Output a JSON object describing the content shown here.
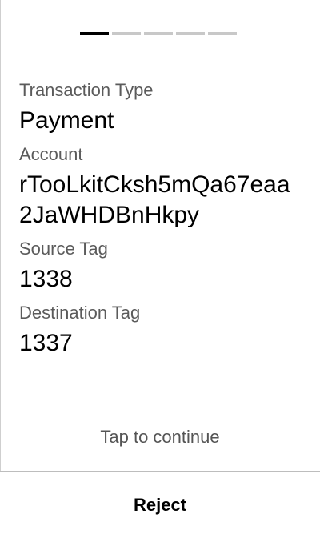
{
  "progress": {
    "total_steps": 5,
    "current_step": 1
  },
  "fields": [
    {
      "label": "Transaction Type",
      "value": "Payment"
    },
    {
      "label": "Account",
      "value": "rTooLkitCksh5mQa67eaa2JaWHDBnHkpy"
    },
    {
      "label": "Source Tag",
      "value": "1338"
    },
    {
      "label": "Destination Tag",
      "value": "1337"
    }
  ],
  "tap_to_continue": "Tap to continue",
  "reject_label": "Reject",
  "colors": {
    "active_step": "#000000",
    "inactive_step": "#c8c8c8",
    "label_text": "#5b5b5b",
    "value_text": "#000000"
  }
}
